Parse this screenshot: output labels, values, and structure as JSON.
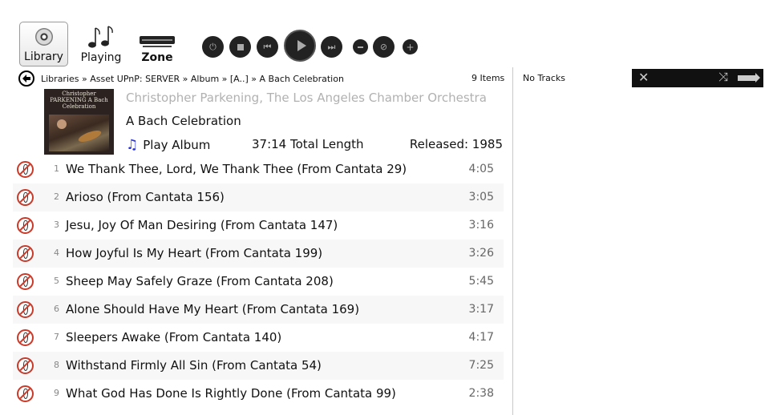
{
  "toolbar": {
    "library_label": "Library",
    "playing_label": "Playing",
    "zone_label": "Zone",
    "icons": {
      "library": "cd-disc-icon",
      "playing": "music-notes-icon",
      "zone": "zone-device-icon",
      "power": "power-icon",
      "stop": "stop-icon",
      "previous": "previous-track-icon",
      "play": "play-icon",
      "next": "next-track-icon",
      "volume_down": "volume-down-icon",
      "mute": "mute-icon",
      "volume_up": "volume-up-icon"
    }
  },
  "breadcrumb": {
    "text": "Libraries » Asset UPnP: SERVER » Album » [A..] » A Bach Celebration",
    "items_count": "9 Items"
  },
  "album": {
    "cover_text": "Christopher PARKENING A Bach Celebration",
    "artist": "Christopher Parkening, The Los Angeles Chamber Orchestra",
    "title": "A Bach Celebration",
    "play_label": "Play Album",
    "total_length": "37:14 Total Length",
    "released": "Released: 1985"
  },
  "tracks": [
    {
      "num": "1",
      "title": "We Thank Thee, Lord, We Thank Thee (From Cantata 29)",
      "duration": "4:05"
    },
    {
      "num": "2",
      "title": "Arioso (From Cantata 156)",
      "duration": "3:05"
    },
    {
      "num": "3",
      "title": "Jesu, Joy Of Man Desiring (From Cantata 147)",
      "duration": "3:16"
    },
    {
      "num": "4",
      "title": "How Joyful Is My Heart (From Cantata 199)",
      "duration": "3:26"
    },
    {
      "num": "5",
      "title": "Sheep May Safely Graze (From Cantata 208)",
      "duration": "5:45"
    },
    {
      "num": "6",
      "title": "Alone Should Have My Heart (From Cantata 169)",
      "duration": "3:17"
    },
    {
      "num": "7",
      "title": "Sleepers Awake (From Cantata 140)",
      "duration": "4:17"
    },
    {
      "num": "8",
      "title": "Withstand Firmly All Sin (From Cantata 54)",
      "duration": "7:25"
    },
    {
      "num": "9",
      "title": "What God Has Done Is Rightly Done (From Cantata 99)",
      "duration": "2:38"
    }
  ],
  "queue": {
    "status": "No Tracks",
    "close_icon": "close-icon",
    "shuffle_icon": "shuffle-icon",
    "arrow_icon": "arrow-right-icon"
  },
  "colors": {
    "accent": "#2b34d8",
    "no_play_icon": "#c83a2a",
    "controls": "#222222",
    "artist_text": "#b1b1b1"
  }
}
